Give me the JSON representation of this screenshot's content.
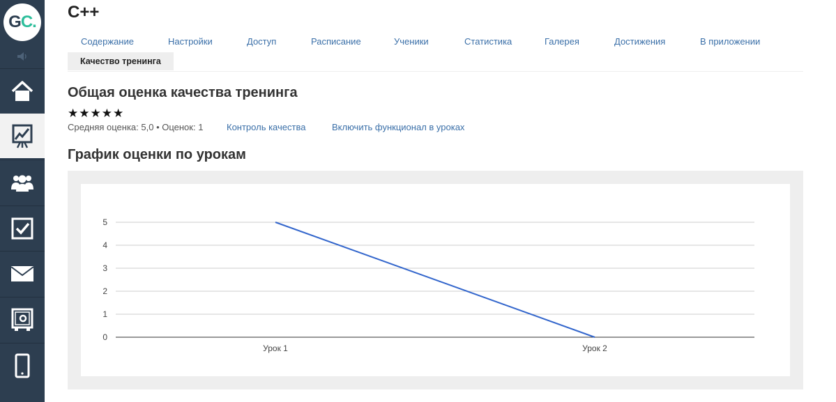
{
  "sidebar": {
    "logo": {
      "g": "G",
      "c": "C."
    },
    "speaker_icon": "speaker-icon",
    "items": [
      {
        "icon": "home-icon",
        "active": false
      },
      {
        "icon": "chart-board-icon",
        "active": true
      },
      {
        "icon": "users-icon",
        "active": false
      },
      {
        "icon": "checkbox-icon",
        "active": false
      },
      {
        "icon": "mail-icon",
        "active": false
      },
      {
        "icon": "safe-icon",
        "active": false
      },
      {
        "icon": "phone-icon",
        "active": false
      }
    ]
  },
  "course": {
    "title": "C++"
  },
  "tabs": [
    {
      "label": "Содержание"
    },
    {
      "label": "Настройки"
    },
    {
      "label": "Доступ"
    },
    {
      "label": "Расписание"
    },
    {
      "label": "Ученики"
    },
    {
      "label": "Статистика"
    },
    {
      "label": "Галерея"
    },
    {
      "label": "Достижения"
    },
    {
      "label": "В приложении"
    },
    {
      "label": "Качество тренинга",
      "active": true
    }
  ],
  "quality": {
    "heading": "Общая оценка качества тренинга",
    "stars": 5,
    "stars_max": 5,
    "rating_text": "Средняя оценка: 5,0 • Оценок: 1",
    "link_control": "Контроль качества",
    "link_enable": "Включить функционал в уроках"
  },
  "chart_section": {
    "heading": "График оценки по урокам"
  },
  "chart_data": {
    "type": "line",
    "categories": [
      "Урок 1",
      "Урок 2"
    ],
    "values": [
      5,
      0
    ],
    "title": "",
    "xlabel": "",
    "ylabel": "",
    "ylim": [
      0,
      5
    ],
    "yticks": [
      0,
      1,
      2,
      3,
      4,
      5
    ],
    "grid": true,
    "line_color": "#3366cc"
  },
  "colors": {
    "sidebar": "#2d3e50",
    "accent": "#2dbe9b",
    "link": "#3a6fa8"
  }
}
